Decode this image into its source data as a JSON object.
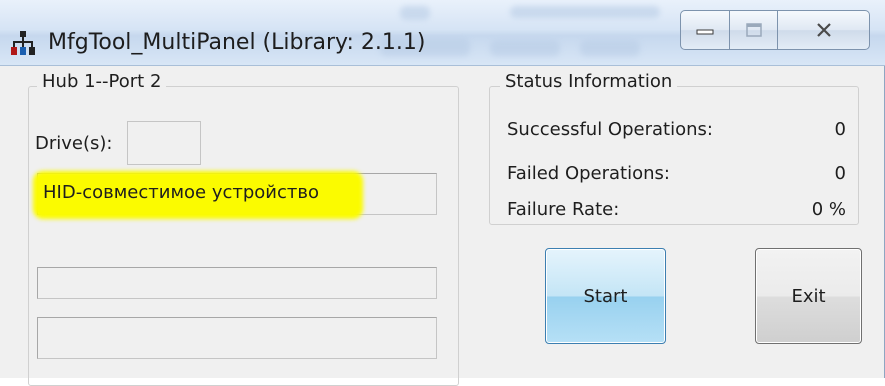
{
  "window": {
    "title": "MfgTool_MultiPanel (Library: 2.1.1)",
    "icons": {
      "app": "usb-hub-tree-icon",
      "minimize": "minimize-icon",
      "maximize": "maximize-icon",
      "close": "close-icon"
    }
  },
  "hub": {
    "group_label": "Hub 1--Port 2",
    "drives_label": "Drive(s):",
    "drives_value": "",
    "device_name": "HID-совместимое устройство",
    "progress_1": "",
    "progress_2": ""
  },
  "status": {
    "group_label": "Status Information",
    "successful_label": "Successful Operations:",
    "successful_value": "0",
    "failed_label": "Failed Operations:",
    "failed_value": "0",
    "failure_rate_label": "Failure Rate:",
    "failure_rate_value": "0 %"
  },
  "buttons": {
    "start": "Start",
    "exit": "Exit"
  },
  "colors": {
    "highlight": "#fbfb00",
    "start_button": "#c4e5f6",
    "titlebar": "#d6e4f5"
  }
}
